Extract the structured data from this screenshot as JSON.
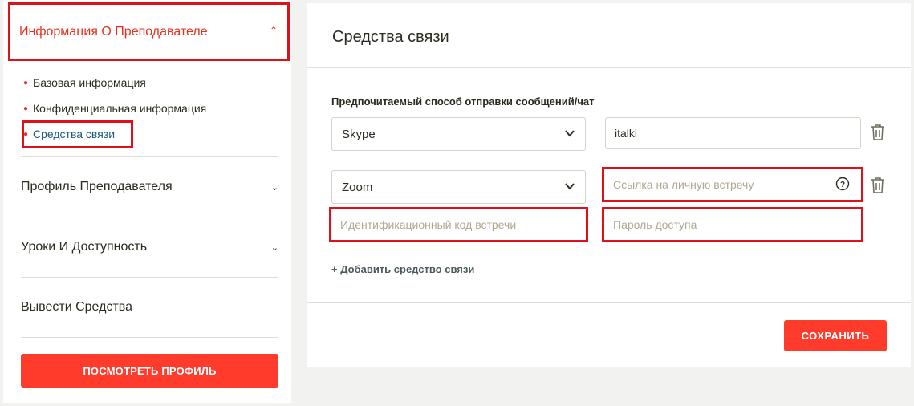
{
  "sidebar": {
    "active_section": "Информация О Преподавателе",
    "subitems": [
      "Базовая информация",
      "Конфиденциальная информация",
      "Средства связи"
    ],
    "sections": [
      "Профиль Преподавателя",
      "Уроки И Доступность",
      "Вывести Средства"
    ],
    "view_profile_label": "ПОСМОТРЕТЬ ПРОФИЛЬ"
  },
  "main": {
    "title": "Средства связи",
    "field_label": "Предпочитаемый способ отправки сообщений/чат",
    "rows": [
      {
        "method": "Skype",
        "value": "italki"
      },
      {
        "method": "Zoom",
        "link_placeholder": "Ссылка на личную встречу",
        "meeting_id_placeholder": "Идентификационный код встречи",
        "password_placeholder": "Пароль доступа"
      }
    ],
    "add_label": "+ Добавить средство связи",
    "save_label": "СОХРАНИТЬ"
  },
  "colors": {
    "accent": "#ff3b2c",
    "highlight": "#e0101a",
    "active_link": "#1a5a7a"
  }
}
